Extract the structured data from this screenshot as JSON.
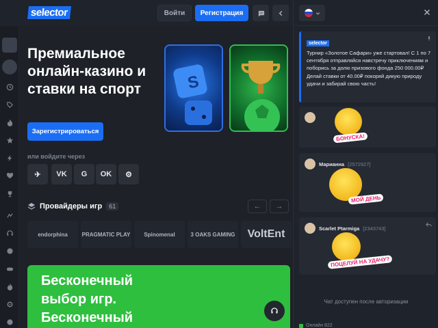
{
  "header": {
    "logo_label": "selector",
    "login_label": "Войти",
    "register_label": "Регистрация",
    "chat_icon": "chat-bubble-icon",
    "collapse_icon": "chevron-left-icon"
  },
  "hero": {
    "title": "Премиальное онлайн-казино и ставки на спорт",
    "cta_label": "Зарегистрироваться"
  },
  "social_login": {
    "title": "или войдите через",
    "providers": [
      "telegram",
      "vk",
      "google",
      "odnoklassniki",
      "steam"
    ],
    "glyphs": [
      "✈",
      "VK",
      "G",
      "OK",
      "⚙"
    ]
  },
  "providers": {
    "title": "Провайдеры игр",
    "count": "61",
    "items": [
      "endorphina",
      "PRAGMATIC PLAY",
      "Spinomenal",
      "3 OAKS GAMING",
      "VoltEnt"
    ]
  },
  "banner": {
    "text": "Бесконечный выбор игр. Бесконечный",
    "color": "#2fbf3f"
  },
  "chat": {
    "close_icon": "close-icon",
    "pinned": {
      "brand": "selector",
      "text": "Турнир «Золотое Сафари» уже стартовал! С 1 по 7 сентября отправляйся навстречу приключениям и поборись за долю призового фонда 250 000.00₽ Делай ставки от 40.00₽ покоряй дикую природу удачи и забирай свою часть!"
    },
    "messages": [
      {
        "name": "",
        "id": "",
        "sticker_label": "БОНУСКА!"
      },
      {
        "name": "Марианна",
        "id": "[2572927]",
        "sticker_label": "МОЙ ДЕНЬ"
      },
      {
        "name": "Scarlet Ptarmiga",
        "id": "[2343743]",
        "sticker_label": "ПОЦЕЛУЙ НА УДАЧУ?"
      }
    ],
    "auth_note": "Чат доступен после авторизации",
    "online_text": "Онлайн 822"
  },
  "colors": {
    "accent": "#1b6ef3",
    "background": "#1b1e25",
    "green": "#2fbf3f"
  }
}
